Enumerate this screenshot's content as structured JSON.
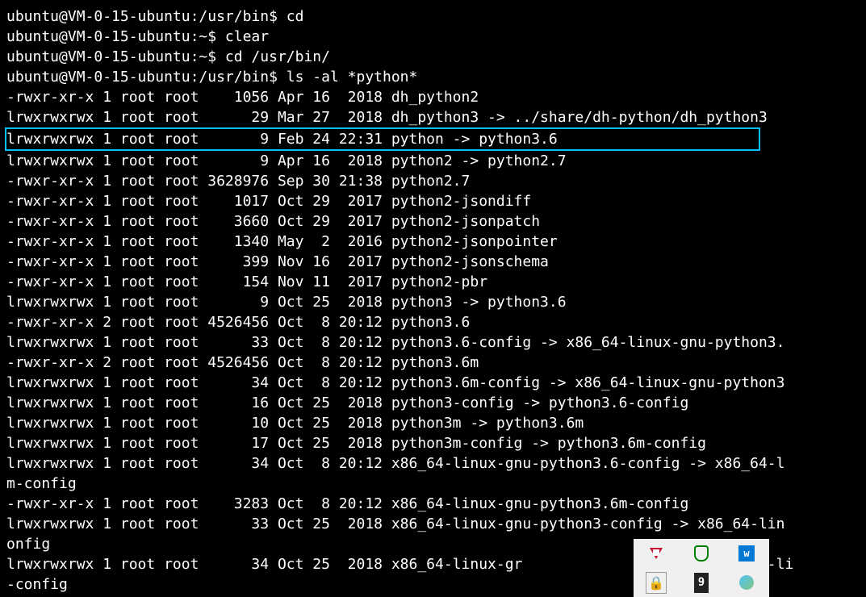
{
  "prompts": [
    {
      "user": "ubuntu@VM-0-15-ubuntu",
      "path": "/usr/bin",
      "sep": "$",
      "cmd": "cd"
    },
    {
      "user": "ubuntu@VM-0-15-ubuntu",
      "path": "~",
      "sep": "$",
      "cmd": "clear"
    },
    {
      "user": "ubuntu@VM-0-15-ubuntu",
      "path": "~",
      "sep": "$",
      "cmd": "cd /usr/bin/"
    },
    {
      "user": "ubuntu@VM-0-15-ubuntu",
      "path": "/usr/bin",
      "sep": "$",
      "cmd": "ls -al *python*"
    }
  ],
  "listing": [
    {
      "perms": "-rwxr-xr-x",
      "links": "1",
      "owner": "root",
      "group": "root",
      "size": "1056",
      "mon": "Apr",
      "day": "16",
      "time": "2018",
      "name": "dh_python2",
      "highlight": false
    },
    {
      "perms": "lrwxrwxrwx",
      "links": "1",
      "owner": "root",
      "group": "root",
      "size": "29",
      "mon": "Mar",
      "day": "27",
      "time": "2018",
      "name": "dh_python3 -> ../share/dh-python/dh_python3",
      "highlight": false
    },
    {
      "perms": "lrwxrwxrwx",
      "links": "1",
      "owner": "root",
      "group": "root",
      "size": "9",
      "mon": "Feb",
      "day": "24",
      "time": "22:31",
      "name": "python -> python3.6",
      "highlight": true
    },
    {
      "perms": "lrwxrwxrwx",
      "links": "1",
      "owner": "root",
      "group": "root",
      "size": "9",
      "mon": "Apr",
      "day": "16",
      "time": "2018",
      "name": "python2 -> python2.7",
      "highlight": false
    },
    {
      "perms": "-rwxr-xr-x",
      "links": "1",
      "owner": "root",
      "group": "root",
      "size": "3628976",
      "mon": "Sep",
      "day": "30",
      "time": "21:38",
      "name": "python2.7",
      "highlight": false
    },
    {
      "perms": "-rwxr-xr-x",
      "links": "1",
      "owner": "root",
      "group": "root",
      "size": "1017",
      "mon": "Oct",
      "day": "29",
      "time": "2017",
      "name": "python2-jsondiff",
      "highlight": false
    },
    {
      "perms": "-rwxr-xr-x",
      "links": "1",
      "owner": "root",
      "group": "root",
      "size": "3660",
      "mon": "Oct",
      "day": "29",
      "time": "2017",
      "name": "python2-jsonpatch",
      "highlight": false
    },
    {
      "perms": "-rwxr-xr-x",
      "links": "1",
      "owner": "root",
      "group": "root",
      "size": "1340",
      "mon": "May",
      "day": "2",
      "time": "2016",
      "name": "python2-jsonpointer",
      "highlight": false
    },
    {
      "perms": "-rwxr-xr-x",
      "links": "1",
      "owner": "root",
      "group": "root",
      "size": "399",
      "mon": "Nov",
      "day": "16",
      "time": "2017",
      "name": "python2-jsonschema",
      "highlight": false
    },
    {
      "perms": "-rwxr-xr-x",
      "links": "1",
      "owner": "root",
      "group": "root",
      "size": "154",
      "mon": "Nov",
      "day": "11",
      "time": "2017",
      "name": "python2-pbr",
      "highlight": false
    },
    {
      "perms": "lrwxrwxrwx",
      "links": "1",
      "owner": "root",
      "group": "root",
      "size": "9",
      "mon": "Oct",
      "day": "25",
      "time": "2018",
      "name": "python3 -> python3.6",
      "highlight": false
    },
    {
      "perms": "-rwxr-xr-x",
      "links": "2",
      "owner": "root",
      "group": "root",
      "size": "4526456",
      "mon": "Oct",
      "day": "8",
      "time": "20:12",
      "name": "python3.6",
      "highlight": false
    },
    {
      "perms": "lrwxrwxrwx",
      "links": "1",
      "owner": "root",
      "group": "root",
      "size": "33",
      "mon": "Oct",
      "day": "8",
      "time": "20:12",
      "name": "python3.6-config -> x86_64-linux-gnu-python3.",
      "highlight": false
    },
    {
      "perms": "-rwxr-xr-x",
      "links": "2",
      "owner": "root",
      "group": "root",
      "size": "4526456",
      "mon": "Oct",
      "day": "8",
      "time": "20:12",
      "name": "python3.6m",
      "highlight": false
    },
    {
      "perms": "lrwxrwxrwx",
      "links": "1",
      "owner": "root",
      "group": "root",
      "size": "34",
      "mon": "Oct",
      "day": "8",
      "time": "20:12",
      "name": "python3.6m-config -> x86_64-linux-gnu-python3",
      "highlight": false
    },
    {
      "perms": "lrwxrwxrwx",
      "links": "1",
      "owner": "root",
      "group": "root",
      "size": "16",
      "mon": "Oct",
      "day": "25",
      "time": "2018",
      "name": "python3-config -> python3.6-config",
      "highlight": false
    },
    {
      "perms": "lrwxrwxrwx",
      "links": "1",
      "owner": "root",
      "group": "root",
      "size": "10",
      "mon": "Oct",
      "day": "25",
      "time": "2018",
      "name": "python3m -> python3.6m",
      "highlight": false
    },
    {
      "perms": "lrwxrwxrwx",
      "links": "1",
      "owner": "root",
      "group": "root",
      "size": "17",
      "mon": "Oct",
      "day": "25",
      "time": "2018",
      "name": "python3m-config -> python3.6m-config",
      "highlight": false
    },
    {
      "perms": "lrwxrwxrwx",
      "links": "1",
      "owner": "root",
      "group": "root",
      "size": "34",
      "mon": "Oct",
      "day": "8",
      "time": "20:12",
      "name": "x86_64-linux-gnu-python3.6-config -> x86_64-l",
      "highlight": false,
      "wrap": "m-config"
    },
    {
      "perms": "-rwxr-xr-x",
      "links": "1",
      "owner": "root",
      "group": "root",
      "size": "3283",
      "mon": "Oct",
      "day": "8",
      "time": "20:12",
      "name": "x86_64-linux-gnu-python3.6m-config",
      "highlight": false
    },
    {
      "perms": "lrwxrwxrwx",
      "links": "1",
      "owner": "root",
      "group": "root",
      "size": "33",
      "mon": "Oct",
      "day": "25",
      "time": "2018",
      "name": "x86_64-linux-gnu-python3-config -> x86_64-lin",
      "highlight": false,
      "wrap": "onfig"
    },
    {
      "perms": "lrwxrwxrwx",
      "links": "1",
      "owner": "root",
      "group": "root",
      "size": "34",
      "mon": "Oct",
      "day": "25",
      "time": "2018",
      "name": "x86_64-linux-gr             onfig -> x86_64-li",
      "highlight": false,
      "wrap": "-config"
    }
  ],
  "tray": {
    "badge_number": "9"
  }
}
